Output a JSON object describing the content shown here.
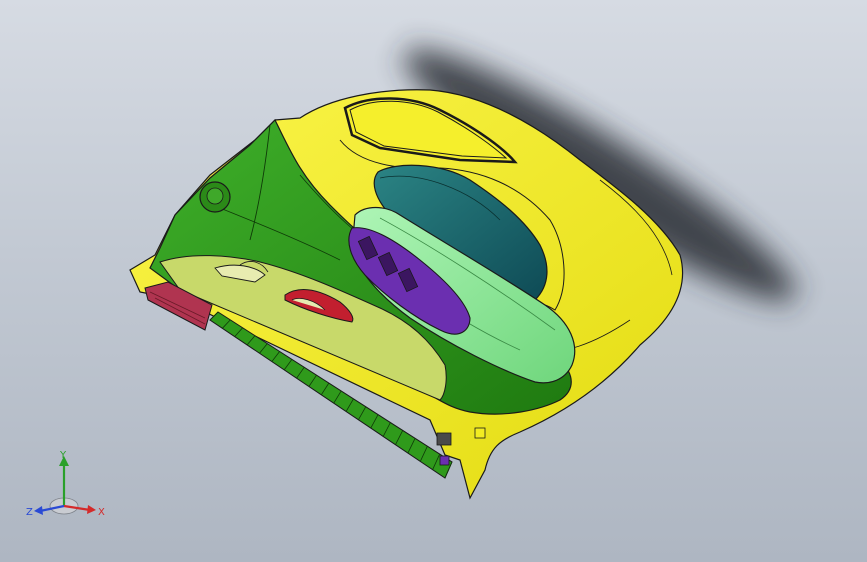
{
  "viewport": {
    "background_top": "#d6dbe3",
    "background_bottom": "#aeb6c2"
  },
  "model": {
    "colors": {
      "outer_panel": "#f2ec22",
      "inner_trim": "#2f9a1b",
      "armrest": "#8fe89a",
      "switch_panel": "#6b2fb0",
      "speaker_grille": "#b03450",
      "map_pocket": "#c8d96a",
      "glass": "#1f6a6a",
      "edge_line": "#1a1a1a"
    }
  },
  "triad": {
    "axes": [
      {
        "label": "Y",
        "color": "#2aa02a",
        "icon": "y-axis-arrow"
      },
      {
        "label": "X",
        "color": "#d42a2a",
        "icon": "x-axis-arrow"
      },
      {
        "label": "Z",
        "color": "#2a4ad4",
        "icon": "z-axis-arrow"
      }
    ]
  }
}
